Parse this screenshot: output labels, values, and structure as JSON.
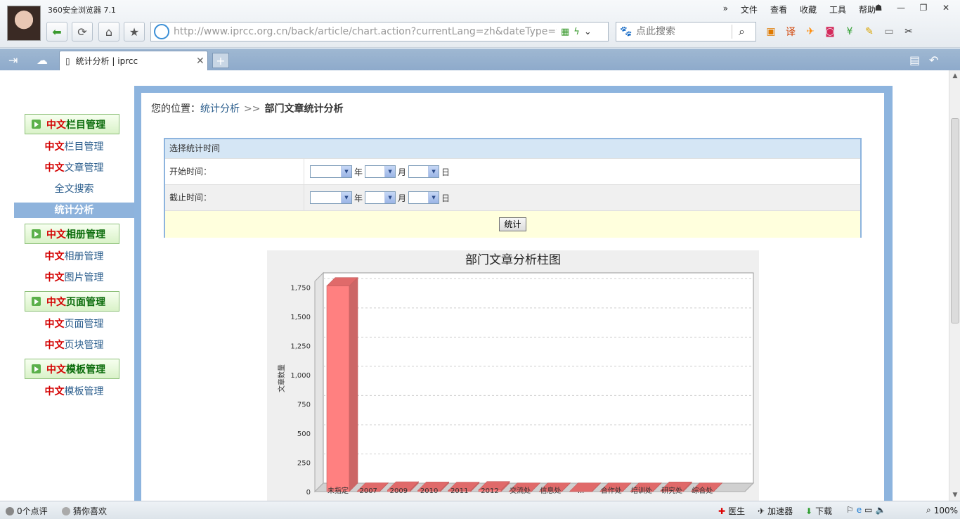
{
  "browser": {
    "app_title": "360安全浏览器 7.1",
    "menu": [
      "文件",
      "查看",
      "收藏",
      "工具",
      "帮助"
    ],
    "url": "http://www.iprcc.org.cn/back/article/chart.action?currentLang=zh&dateType=year",
    "search_placeholder": "点此搜索",
    "tab_title": "统计分析 | iprcc"
  },
  "sidebar": {
    "categories": [
      {
        "red": "中文",
        "green": "栏目管理",
        "links": [
          {
            "red": "中文",
            "rest": "栏目管理"
          },
          {
            "red": "中文",
            "rest": "文章管理"
          }
        ]
      },
      {
        "red": "中文",
        "green": "相册管理",
        "links": [
          {
            "red": "中文",
            "rest": "相册管理"
          },
          {
            "red": "中文",
            "rest": "图片管理"
          }
        ]
      },
      {
        "red": "中文",
        "green": "页面管理",
        "links": [
          {
            "red": "中文",
            "rest": "页面管理"
          },
          {
            "red": "中文",
            "rest": "页块管理"
          }
        ]
      },
      {
        "red": "中文",
        "green": "模板管理",
        "links": [
          {
            "red": "中文",
            "rest": "模板管理"
          }
        ]
      }
    ],
    "plain_links": [
      "全文搜索",
      "统计分析"
    ]
  },
  "breadcrumb": {
    "prefix": "您的位置：",
    "link": "统计分析",
    "sep": ">>",
    "current": "部门文章统计分析"
  },
  "filter": {
    "title": "选择统计时间",
    "start_label": "开始时间：",
    "end_label": "截止时间：",
    "year": "年",
    "month": "月",
    "day": "日",
    "submit": "统计"
  },
  "chart_data": {
    "type": "bar",
    "title": "部门文章分析柱图",
    "ylabel": "文章数量",
    "xlabel": "",
    "categories": [
      "未指定",
      "2007",
      "2009",
      "2010",
      "2011",
      "2012",
      "交流处",
      "信息处",
      "...",
      "合作处",
      "培训处",
      "研究处",
      "综合处"
    ],
    "values": [
      1760,
      3,
      12,
      10,
      9,
      14,
      2,
      2,
      2,
      2,
      2,
      10,
      2
    ],
    "ylim": [
      0,
      1800
    ],
    "yticks": [
      "0",
      "250",
      "500",
      "750",
      "1,000",
      "1,250",
      "1,500",
      "1,750"
    ],
    "grid": true,
    "colors": {
      "bar": "#ff8080",
      "bar_top": "#e06a6a",
      "bar_side": "#cc6666",
      "floor": "#d0d0d0",
      "bg": "#efefef",
      "plot": "#ffffff"
    }
  },
  "statusbar": {
    "comments": "0个点评",
    "guess": "猜你喜欢",
    "doctor": "医生",
    "accelerator": "加速器",
    "download": "下载",
    "zoom": "100%"
  }
}
